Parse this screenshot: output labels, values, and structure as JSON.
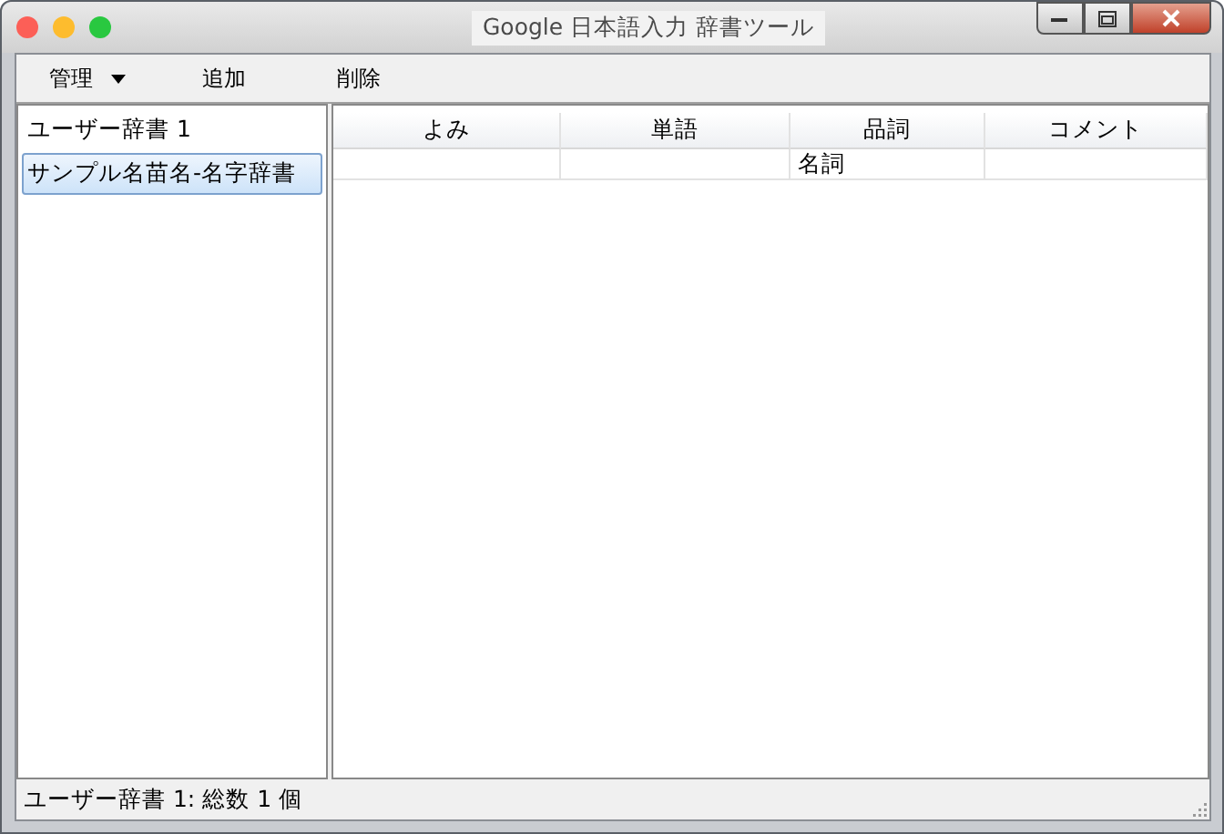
{
  "window": {
    "title": "Google 日本語入力 辞書ツール"
  },
  "toolbar": [
    {
      "label": "管理",
      "kind": "menu"
    },
    {
      "label": "追加",
      "kind": "button"
    },
    {
      "label": "削除",
      "kind": "button"
    }
  ],
  "sidebar": {
    "items": [
      {
        "label": "ユーザー辞書 1",
        "selected": false
      },
      {
        "label": "サンプル名苗名-名字辞書",
        "selected": true
      }
    ]
  },
  "table": {
    "columns": [
      "よみ",
      "単語",
      "品詞",
      "コメント"
    ],
    "rows": [
      {
        "part_of_speech": "名詞"
      }
    ]
  },
  "status_bar": "ユーザー辞書 1: 総数 1 個"
}
